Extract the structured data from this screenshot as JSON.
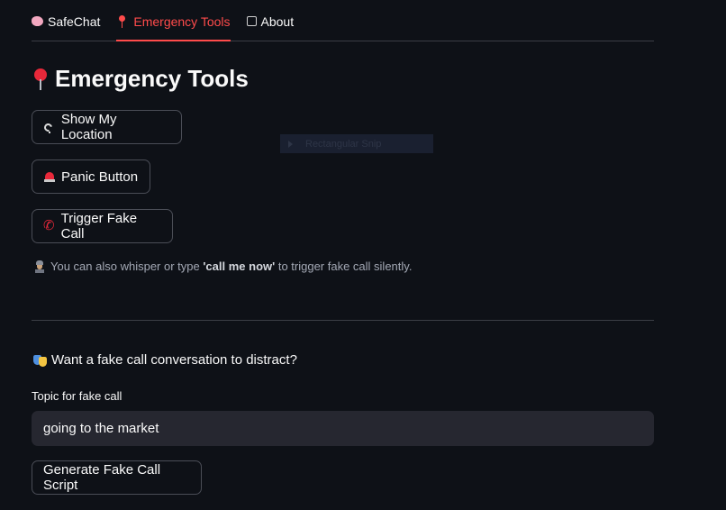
{
  "tabs": [
    {
      "label": "SafeChat",
      "icon": "brain-icon",
      "active": false
    },
    {
      "label": "Emergency Tools",
      "icon": "pin-icon",
      "active": true
    },
    {
      "label": "About",
      "icon": "info-icon",
      "active": false
    }
  ],
  "page_title": "Emergency Tools",
  "buttons": {
    "location": "Show My Location",
    "panic": "Panic Button",
    "fake_call": "Trigger Fake Call",
    "generate": "Generate Fake Call Script"
  },
  "hint": {
    "prefix": "You can also whisper or type ",
    "keyword": "'call me now'",
    "suffix": " to trigger fake call silently."
  },
  "question": "Want a fake call conversation to distract?",
  "topic_field": {
    "label": "Topic for fake call",
    "value": "going to the market"
  },
  "overlay": {
    "label": "Rectangular Snip"
  },
  "colors": {
    "background": "#0e1117",
    "accent": "#ff4b4b",
    "input_bg": "#262730"
  }
}
